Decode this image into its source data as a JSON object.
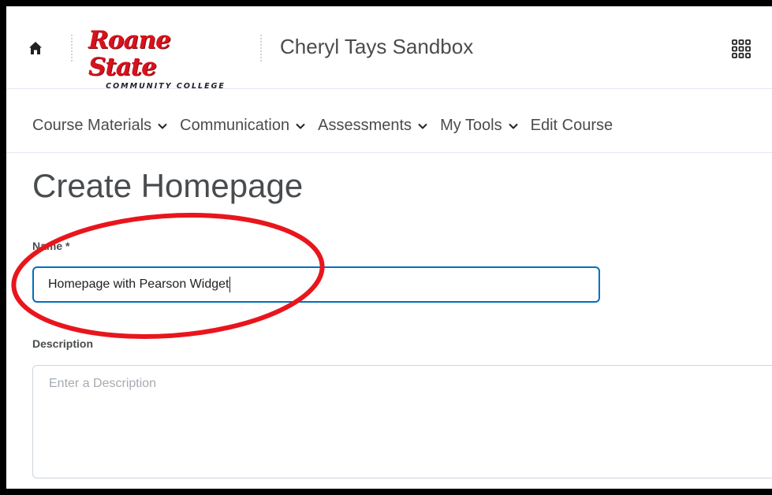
{
  "header": {
    "logo": {
      "main": "Roane State",
      "sub": "COMMUNITY COLLEGE"
    },
    "course_title": "Cheryl Tays Sandbox"
  },
  "nav": {
    "items": [
      {
        "label": "Course Materials",
        "dropdown": true
      },
      {
        "label": "Communication",
        "dropdown": true
      },
      {
        "label": "Assessments",
        "dropdown": true
      },
      {
        "label": "My Tools",
        "dropdown": true
      },
      {
        "label": "Edit Course",
        "dropdown": false
      }
    ]
  },
  "page": {
    "title": "Create Homepage",
    "name_label": "Name *",
    "name_value": "Homepage with Pearson Widget",
    "description_label": "Description",
    "description_placeholder": "Enter a Description"
  },
  "colors": {
    "brand_red": "#d6121d",
    "text": "#494c4e",
    "focus_blue": "#006fbf",
    "annotation_red": "#e8161c"
  },
  "icons": [
    "home-icon",
    "waffle-icon",
    "chevron-down-icon"
  ]
}
